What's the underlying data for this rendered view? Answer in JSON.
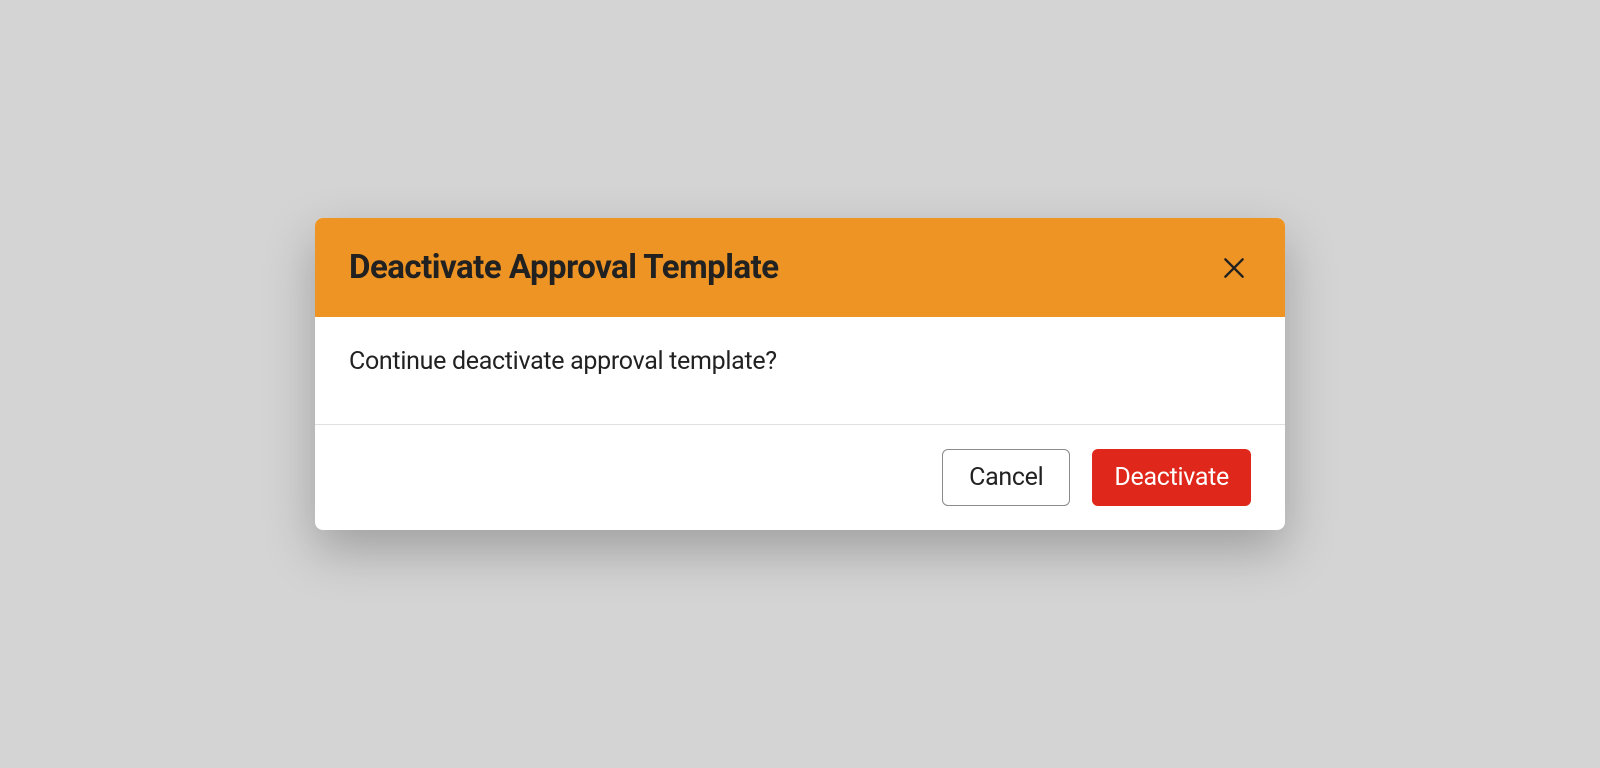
{
  "modal": {
    "title": "Deactivate Approval Template",
    "message": "Continue deactivate approval template?",
    "cancel_label": "Cancel",
    "confirm_label": "Deactivate"
  },
  "colors": {
    "header_bg": "#ed9424",
    "confirm_bg": "#df281b",
    "backdrop": "#d4d4d4"
  }
}
